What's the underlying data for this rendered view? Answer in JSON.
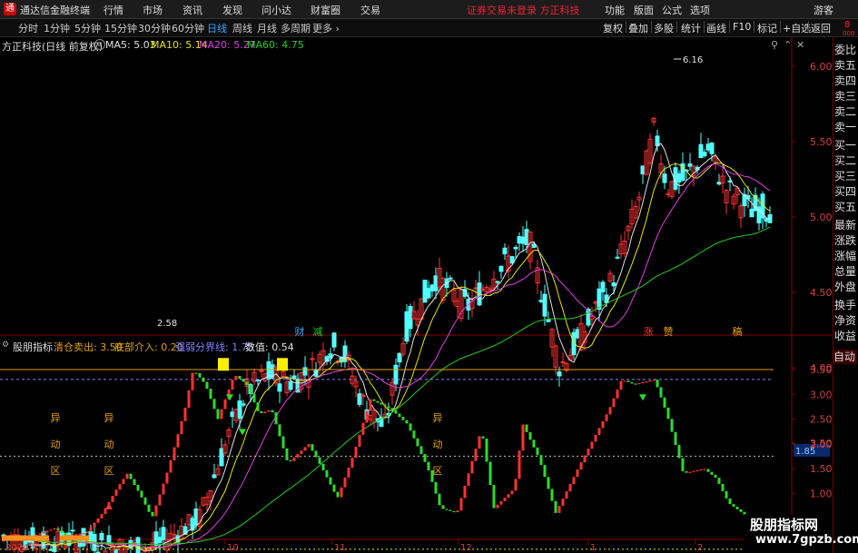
{
  "titlebar": {
    "logo_text": "通",
    "app_name": "通达信金融终端",
    "menu": [
      "行情",
      "市场",
      "资讯",
      "发现",
      "问小达",
      "财富圈",
      "交易"
    ],
    "notice": "证券交易未登录  方正科技",
    "right_menu": [
      "功能",
      "版面",
      "公式",
      "选项",
      "游客"
    ]
  },
  "toolbar": {
    "periods": [
      "分时",
      "1分钟",
      "5分钟",
      "15分钟",
      "30分钟",
      "60分钟",
      "日线",
      "周线",
      "月线",
      "多周期",
      "更多 ›"
    ],
    "active_period": "日线",
    "right_tools": [
      "复权",
      "叠加",
      "多股",
      "统计",
      "画线",
      "F10",
      "标记",
      "+自选",
      "返回"
    ]
  },
  "main_chart": {
    "stock_label": "方正科技(日线 前复权)",
    "ma_legend": [
      {
        "label": "MA5: 5.03",
        "color": "#e0e0e0"
      },
      {
        "label": "MA10: 5.14",
        "color": "#e6e600"
      },
      {
        "label": "MA20: 5.27",
        "color": "#e040e0"
      },
      {
        "label": "MA60: 4.75",
        "color": "#22cc22"
      }
    ],
    "price_axis": [
      "6.00",
      "5.50",
      "5.00",
      "4.50",
      "4.00",
      "3.50",
      "3.00"
    ],
    "high_label": "6.16",
    "low_label": "2.58",
    "event_labels": [
      {
        "text": "财",
        "color": "#37a3ff"
      },
      {
        "text": "减",
        "color": "#22cc22"
      },
      {
        "text": "涨",
        "color": "#ff3030"
      },
      {
        "text": "赞",
        "color": "#e6a000"
      },
      {
        "text": "稿",
        "color": "#e6a000"
      }
    ],
    "top_right_label": "8",
    "top_right_sub": "000"
  },
  "sub_chart": {
    "indicator_name": "股朋指标",
    "legend": [
      {
        "label": "清仓卖出: 3.50",
        "color": "#e6a000"
      },
      {
        "label": "底部介入: 0.20",
        "color": "#e6a000"
      },
      {
        "label": "强弱分界线: 1.75",
        "color": "#8080ff"
      },
      {
        "label": "数值: 0.54",
        "color": "#e0e0e0"
      }
    ],
    "value_axis": [
      "3.50",
      "3.00",
      "2.50",
      "2.00",
      "1.50",
      "1.00"
    ],
    "current_value_tag": "1.85",
    "annotations": [
      "异",
      "动",
      "区"
    ],
    "date_axis": [
      "2024年",
      "9",
      "10",
      "11",
      "12",
      "1",
      "2"
    ]
  },
  "right_panel": {
    "items": [
      "委比",
      "卖五",
      "卖四",
      "卖三",
      "卖二",
      "卖一",
      "买一",
      "买二",
      "买三",
      "买四",
      "买五",
      "最新",
      "涨跌",
      "涨幅",
      "总量",
      "外盘",
      "换手",
      "净资",
      "收益"
    ],
    "auto_label": "自动"
  },
  "watermark": {
    "line1": "股朋指标网",
    "line2": "www.7gpzb.com"
  }
}
